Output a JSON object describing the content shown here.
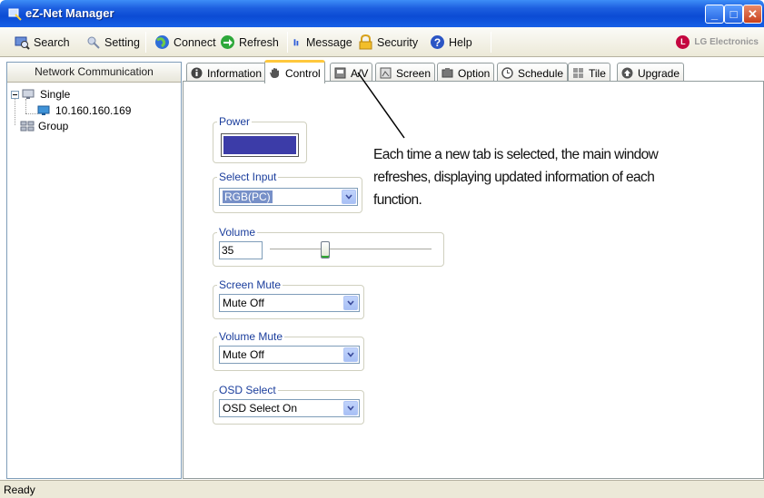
{
  "window": {
    "title": "eZ-Net Manager"
  },
  "toolbar": {
    "search": "Search",
    "setting": "Setting",
    "connect": "Connect",
    "refresh": "Refresh",
    "message": "Message",
    "security": "Security",
    "help": "Help",
    "brand": "LG Electronics"
  },
  "left_panel": {
    "header": "Network Communication",
    "tree": {
      "single": "Single",
      "ip": "10.160.160.169",
      "group": "Group"
    }
  },
  "tabs": [
    {
      "label": "Information",
      "icon": "info-icon"
    },
    {
      "label": "Control",
      "icon": "hand-icon",
      "active": true
    },
    {
      "label": "A/V",
      "icon": "av-icon"
    },
    {
      "label": "Screen",
      "icon": "screen-icon"
    },
    {
      "label": "Option",
      "icon": "option-icon"
    },
    {
      "label": "Schedule",
      "icon": "clock-icon"
    },
    {
      "label": "Tile",
      "icon": "tile-icon"
    },
    {
      "label": "Upgrade",
      "icon": "upgrade-icon"
    }
  ],
  "control": {
    "power": {
      "label": "Power",
      "color": "#3c3ca8"
    },
    "select_input": {
      "label": "Select Input",
      "value": "RGB(PC)"
    },
    "volume": {
      "label": "Volume",
      "value": "35",
      "slider_fraction": 0.34
    },
    "screen_mute": {
      "label": "Screen Mute",
      "value": "Mute Off"
    },
    "volume_mute": {
      "label": "Volume Mute",
      "value": "Mute Off"
    },
    "osd_select": {
      "label": "OSD Select",
      "value": "OSD Select On"
    }
  },
  "annotation": "Each time a new tab is selected, the main window refreshes, displaying updated information of each function.",
  "status": "Ready"
}
